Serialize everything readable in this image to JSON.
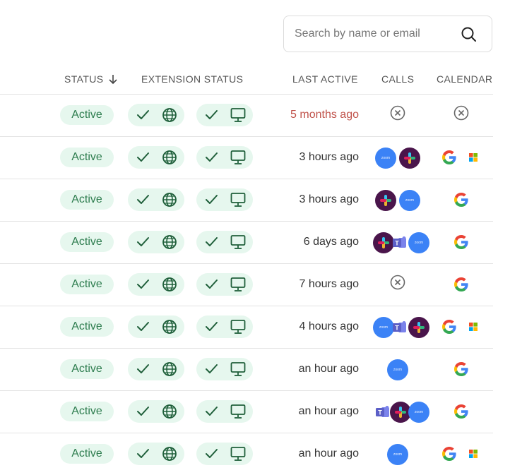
{
  "search": {
    "placeholder": "Search by name or email"
  },
  "headers": {
    "status": "STATUS",
    "extension_status": "EXTENSION STATUS",
    "last_active": "LAST ACTIVE",
    "calls": "CALLS",
    "calendars": "CALENDARS"
  },
  "colors": {
    "active_badge_bg": "#e6f7ee",
    "active_badge_text": "#2e7d4f",
    "stale_text": "#c0524a",
    "zoom": "#3b82f6",
    "slack": "#4a154b",
    "teams": "#5b5fc7"
  },
  "rows": [
    {
      "status": "Active",
      "browser_extension": "installed",
      "desktop_app": "installed",
      "last_active": "5 months ago",
      "stale": true,
      "calls": [
        "none"
      ],
      "calendars": [
        "none"
      ]
    },
    {
      "status": "Active",
      "browser_extension": "installed",
      "desktop_app": "installed",
      "last_active": "3 hours ago",
      "stale": false,
      "calls": [
        "zoom",
        "slack"
      ],
      "calendars": [
        "google",
        "microsoft"
      ]
    },
    {
      "status": "Active",
      "browser_extension": "installed",
      "desktop_app": "installed",
      "last_active": "3 hours ago",
      "stale": false,
      "calls": [
        "slack",
        "zoom"
      ],
      "calendars": [
        "google"
      ]
    },
    {
      "status": "Active",
      "browser_extension": "installed",
      "desktop_app": "installed",
      "last_active": "6 days ago",
      "stale": false,
      "calls": [
        "slack",
        "teams",
        "zoom"
      ],
      "calendars": [
        "google"
      ]
    },
    {
      "status": "Active",
      "browser_extension": "installed",
      "desktop_app": "installed",
      "last_active": "7 hours ago",
      "stale": false,
      "calls": [
        "none"
      ],
      "calendars": [
        "google"
      ]
    },
    {
      "status": "Active",
      "browser_extension": "installed",
      "desktop_app": "installed",
      "last_active": "4 hours ago",
      "stale": false,
      "calls": [
        "zoom",
        "teams",
        "slack"
      ],
      "calendars": [
        "google",
        "microsoft"
      ]
    },
    {
      "status": "Active",
      "browser_extension": "installed",
      "desktop_app": "installed",
      "last_active": "an hour ago",
      "stale": false,
      "calls": [
        "zoom"
      ],
      "calendars": [
        "google"
      ]
    },
    {
      "status": "Active",
      "browser_extension": "installed",
      "desktop_app": "installed",
      "last_active": "an hour ago",
      "stale": false,
      "calls": [
        "teams",
        "slack",
        "zoom"
      ],
      "calendars": [
        "google"
      ]
    },
    {
      "status": "Active",
      "browser_extension": "installed",
      "desktop_app": "installed",
      "last_active": "an hour ago",
      "stale": false,
      "calls": [
        "zoom"
      ],
      "calendars": [
        "google",
        "microsoft"
      ]
    }
  ]
}
